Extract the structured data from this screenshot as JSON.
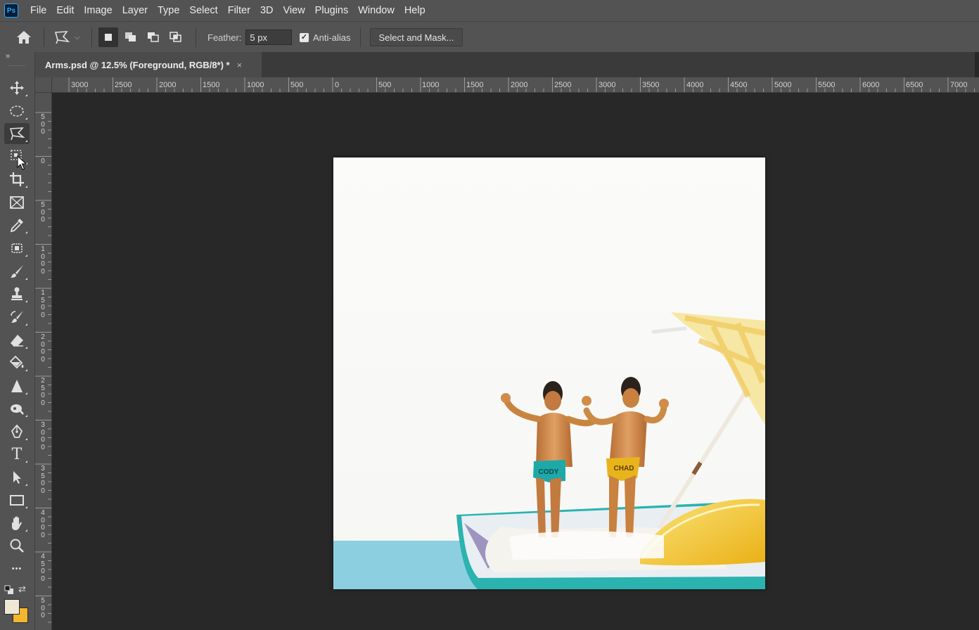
{
  "app": {
    "logo_text": "Ps",
    "accent": "#31a8ff"
  },
  "menu": [
    "File",
    "Edit",
    "Image",
    "Layer",
    "Type",
    "Select",
    "Filter",
    "3D",
    "View",
    "Plugins",
    "Window",
    "Help"
  ],
  "options": {
    "home_icon": "home-icon",
    "tool_preset_icon": "polygonal-lasso-icon",
    "selection_modes": [
      "new-selection",
      "add-to-selection",
      "subtract-from-selection",
      "intersect-with-selection"
    ],
    "feather_label": "Feather:",
    "feather_value": "5 px",
    "anti_alias_label": "Anti-alias",
    "anti_alias_checked": true,
    "select_and_mask_label": "Select and Mask..."
  },
  "tab": {
    "title": "Arms.psd @ 12.5% (Foreground, RGB/8*) *",
    "close": "×"
  },
  "rulers": {
    "top_labels": [
      "3000",
      "2500",
      "2000",
      "1500",
      "1000",
      "500",
      "0",
      "500",
      "1000",
      "1500",
      "2000",
      "2500",
      "3000",
      "3500",
      "4000",
      "4500",
      "5000",
      "5500",
      "6000",
      "6500",
      "7000"
    ],
    "left_labels": [
      "5\n0\n0",
      "0",
      "5\n0\n0",
      "1\n0\n0\n0",
      "1\n5\n0\n0",
      "2\n0\n0\n0",
      "2\n5\n0\n0",
      "3\n0\n0\n0",
      "3\n5\n0\n0",
      "4\n0\n0\n0",
      "4\n5\n0\n0",
      "5\n0\n0"
    ]
  },
  "toolbar": {
    "collapse": "»",
    "tools": [
      "move",
      "elliptical-marquee",
      "polygonal-lasso",
      "object-selection",
      "crop",
      "frame",
      "eyedropper",
      "spot-healing",
      "brush",
      "clone-stamp",
      "history-brush",
      "eraser",
      "paint-bucket",
      "sharpen",
      "dodge",
      "pen",
      "type",
      "path-selection",
      "rectangle",
      "hand",
      "zoom",
      "more"
    ],
    "active_tool": "polygonal-lasso",
    "type_tool_glyph": "T",
    "more_glyph": "•••",
    "swap_glyph": "⇄",
    "foreground_color": "#efe6d6",
    "background_color": "#f3b72d"
  },
  "image": {
    "swimsuit_left": "CODY",
    "swimsuit_right": "CHAD",
    "colors": {
      "teal": "#1fa8a8",
      "yellow": "#e8b41c",
      "skin": "#d28a4a",
      "water": "#8ccfe0",
      "lemon": "#f2c21b"
    }
  }
}
